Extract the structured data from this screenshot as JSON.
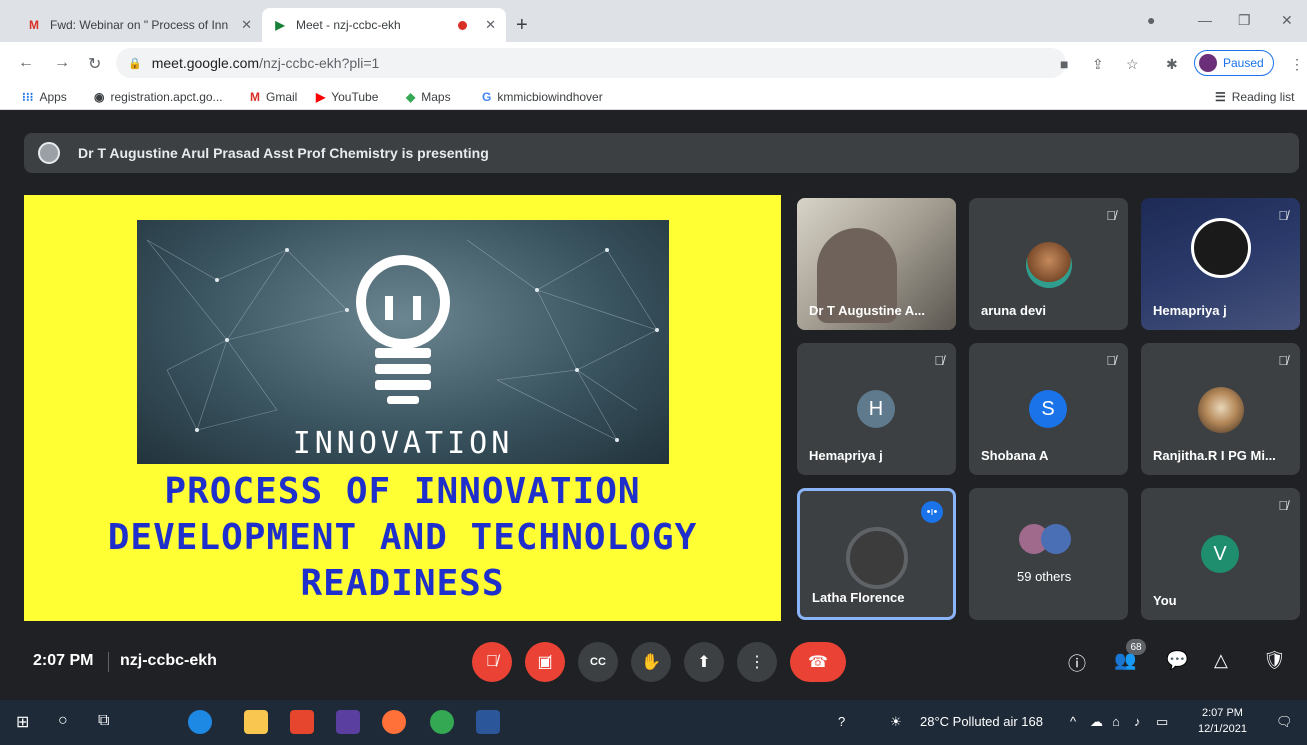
{
  "browser": {
    "tabs": [
      {
        "title": "Fwd: Webinar on \" Process of Inn",
        "icon": "gmail-icon"
      },
      {
        "title": "Meet - nzj-ccbc-ekh",
        "icon": "meet-icon",
        "recording": true
      }
    ],
    "url_host": "meet.google.com",
    "url_path": "/nzj-ccbc-ekh?pli=1",
    "profile_label": "Paused",
    "bookmarks": [
      "Apps",
      "registration.apct.go...",
      "Gmail",
      "YouTube",
      "Maps",
      "kmmicbiowindhover"
    ],
    "reading_list": "Reading list"
  },
  "meet": {
    "presenting_banner": "Dr T Augustine Arul Prasad Asst Prof Chemistry is presenting",
    "slide": {
      "image_word": "INNOVATION",
      "title_lines": [
        "PROCESS OF INNOVATION",
        "DEVELOPMENT AND TECHNOLOGY",
        "READINESS"
      ]
    },
    "participants": [
      {
        "name": "Dr T Augustine A...",
        "muted": false,
        "kind": "video"
      },
      {
        "name": "aruna devi",
        "muted": true,
        "kind": "photo"
      },
      {
        "name": "Hemapriya j",
        "muted": true,
        "kind": "logo"
      },
      {
        "name": "Hemapriya j",
        "muted": true,
        "kind": "initial",
        "initial": "H",
        "color": "#5f7a8c"
      },
      {
        "name": "Shobana A",
        "muted": true,
        "kind": "initial",
        "initial": "S",
        "color": "#1a73e8"
      },
      {
        "name": "Ranjitha.R I PG Mi...",
        "muted": true,
        "kind": "photo"
      },
      {
        "name": "Latha Florence",
        "muted": false,
        "kind": "photo",
        "speaking": true
      },
      {
        "name": "59 others",
        "muted": false,
        "kind": "group"
      },
      {
        "name": "You",
        "muted": true,
        "kind": "initial",
        "initial": "V",
        "color": "#1e8e6e"
      }
    ],
    "bar": {
      "time": "2:07 PM",
      "meeting_code": "nzj-ccbc-ekh",
      "participant_count": "68"
    }
  },
  "taskbar": {
    "weather": "28°C  Polluted air 168",
    "time": "2:07 PM",
    "date": "12/1/2021"
  },
  "colors": {
    "meet_bg": "#202124",
    "tile_bg": "#3c4043",
    "slide_bg": "#ffff33",
    "slide_text": "#1f2fcc",
    "danger": "#ea4335"
  }
}
